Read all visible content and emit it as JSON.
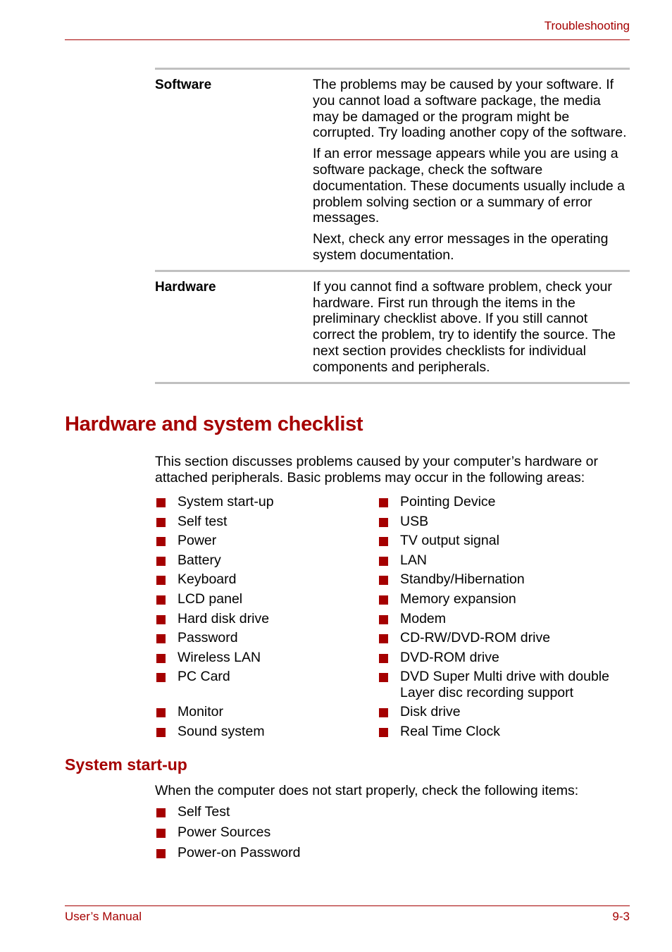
{
  "header": {
    "section": "Troubleshooting"
  },
  "table": {
    "rows": [
      {
        "label": "Software",
        "paragraphs": [
          "The problems may be caused by your software. If you cannot load a software package, the media may be damaged or the program might be corrupted. Try loading another copy of the software.",
          "If an error message appears while you are using a software package, check the software documentation. These documents usually include a problem solving section or a summary of error messages.",
          "Next, check any error messages in the operating system documentation."
        ]
      },
      {
        "label": "Hardware",
        "paragraphs": [
          "If you cannot find a software problem, check your hardware. First run through the items in the preliminary checklist above. If you still cannot correct the problem, try to identify the source. The next section provides checklists for individual components and peripherals."
        ]
      }
    ]
  },
  "checklist": {
    "title": "Hardware and system checklist",
    "intro": "This section discusses problems caused by your computer’s hardware or attached peripherals. Basic problems may occur in the following areas:",
    "left_items": [
      "System start-up",
      "Self test",
      "Power",
      "Battery",
      "Keyboard",
      "LCD panel",
      "Hard disk drive",
      "Password",
      "Wireless LAN",
      "PC Card",
      "Monitor",
      "Sound system"
    ],
    "right_items": [
      "Pointing Device",
      "USB",
      "TV output signal",
      "LAN",
      "Standby/Hibernation",
      "Memory expansion",
      "Modem",
      "CD-RW/DVD-ROM drive",
      "DVD-ROM drive",
      "DVD Super Multi drive with double Layer disc recording support",
      "Disk drive",
      "Real Time Clock"
    ]
  },
  "startup": {
    "title": "System start-up",
    "intro": "When the computer does not start properly, check the following items:",
    "items": [
      "Self Test",
      "Power Sources",
      "Power-on Password"
    ]
  },
  "footer": {
    "left": "User’s Manual",
    "right": "9-3"
  },
  "colors": {
    "accent": "#a50000",
    "table_rule": "#c0c0c0"
  }
}
